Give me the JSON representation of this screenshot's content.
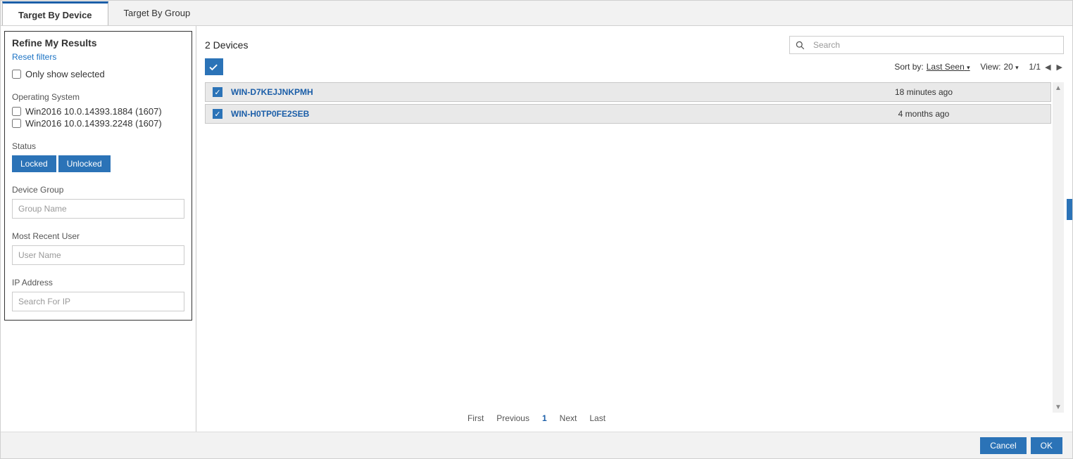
{
  "tabs": [
    {
      "label": "Target By Device",
      "active": true
    },
    {
      "label": "Target By Group",
      "active": false
    }
  ],
  "sidebar": {
    "title": "Refine My Results",
    "reset_label": "Reset filters",
    "only_selected_label": "Only show selected",
    "os": {
      "label": "Operating System",
      "items": [
        "Win2016 10.0.14393.1884 (1607)",
        "Win2016 10.0.14393.2248 (1607)"
      ]
    },
    "status": {
      "label": "Status",
      "options": [
        "Locked",
        "Unlocked"
      ]
    },
    "device_group": {
      "label": "Device Group",
      "placeholder": "Group Name"
    },
    "most_recent_user": {
      "label": "Most Recent User",
      "placeholder": "User Name"
    },
    "ip_address": {
      "label": "IP Address",
      "placeholder": "Search For IP"
    }
  },
  "main": {
    "device_count_label": "2 Devices",
    "search_placeholder": "Search",
    "sort_by_label": "Sort by:",
    "sort_by_value": "Last Seen",
    "view_label": "View:",
    "view_value": "20",
    "page_display": "1/1",
    "devices": [
      {
        "name": "WIN-D7KEJJNKPMH",
        "last_seen": "18 minutes ago",
        "selected": true
      },
      {
        "name": "WIN-H0TP0FE2SEB",
        "last_seen": "4 months ago",
        "selected": true
      }
    ]
  },
  "pagination": {
    "first": "First",
    "previous": "Previous",
    "current": "1",
    "next": "Next",
    "last": "Last"
  },
  "footer": {
    "cancel": "Cancel",
    "ok": "OK"
  },
  "colors": {
    "accent": "#2b73b7",
    "link": "#1b5ea8"
  }
}
